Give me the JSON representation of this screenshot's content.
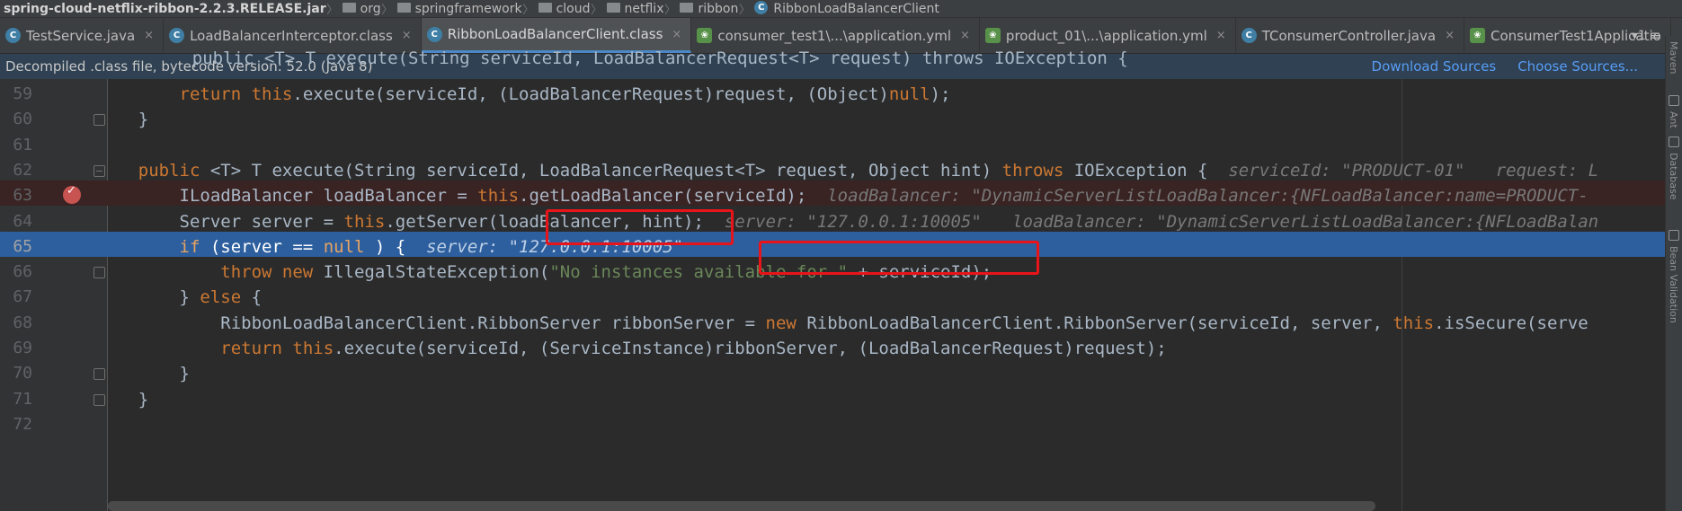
{
  "breadcrumb": {
    "items": [
      "spring-cloud-netflix-ribbon-2.2.3.RELEASE.jar",
      "org",
      "springframework",
      "cloud",
      "netflix",
      "ribbon",
      "RibbonLoadBalancerClient"
    ]
  },
  "tabs": [
    {
      "label": "TestService.java",
      "icon": "java-class-icon"
    },
    {
      "label": "LoadBalancerInterceptor.class",
      "icon": "class-file-icon"
    },
    {
      "label": "RibbonLoadBalancerClient.class",
      "icon": "class-file-icon",
      "active": true
    },
    {
      "label": "consumer_test1\\...\\application.yml",
      "icon": "spring-yml-icon"
    },
    {
      "label": "product_01\\...\\application.yml",
      "icon": "spring-yml-icon"
    },
    {
      "label": "TConsumerController.java",
      "icon": "java-class-icon"
    },
    {
      "label": "ConsumerTest1Applicatio",
      "icon": "spring-app-icon"
    }
  ],
  "tab_close": "×",
  "tab_overflow": "▾1 ≡",
  "banner": {
    "text": "Decompiled .class file, bytecode version: 52.0 (Java 8)",
    "download_sources": "Download Sources",
    "choose_sources": "Choose Sources..."
  },
  "right_strip": {
    "maven": "Maven",
    "ant": "Ant",
    "database": "Database",
    "bean_validation": "Bean Validation"
  },
  "code": {
    "partial_top": "    public <T> T execute(String serviceId, LoadBalancerRequest<T> request) throws IOException {",
    "lines": [
      {
        "num": "59",
        "parts": [
          [
            "",
            "        "
          ],
          [
            "kw",
            "return"
          ],
          [
            "",
            " "
          ],
          [
            "kw",
            "this"
          ],
          [
            "",
            ".execute(serviceId, (LoadBalancerRequest)request, (Object)"
          ],
          [
            "kw",
            "null"
          ],
          [
            "",
            ");"
          ]
        ]
      },
      {
        "num": "60",
        "parts": [
          [
            "",
            "    }"
          ]
        ]
      },
      {
        "num": "61",
        "parts": [
          [
            "",
            ""
          ]
        ]
      },
      {
        "num": "62",
        "parts": [
          [
            "",
            "    "
          ],
          [
            "kw",
            "public"
          ],
          [
            "",
            " <T> T execute(String serviceId, LoadBalancerRequest<T> request, Object hint) "
          ],
          [
            "kw",
            "throws"
          ],
          [
            "",
            " IOException {  "
          ],
          [
            "hint",
            "serviceId: \"PRODUCT-01\"   request: L"
          ]
        ]
      },
      {
        "num": "63",
        "parts": [
          [
            "",
            "        ILoadBalancer loadBalancer = "
          ],
          [
            "kw",
            "this"
          ],
          [
            "",
            ".getLoadBalancer(serviceId);  "
          ],
          [
            "hint",
            "loadBalancer: \"DynamicServerListLoadBalancer:{NFLoadBalancer:name=PRODUCT-"
          ]
        ]
      },
      {
        "num": "64",
        "parts": [
          [
            "",
            "        Server server = "
          ],
          [
            "kw",
            "this"
          ],
          [
            "",
            ".getServer(loadBalancer, hint);  "
          ],
          [
            "hint",
            "server: \"127.0.0.1:10005\"   loadBalancer: \"DynamicServerListLoadBalancer:{NFLoadBalan"
          ]
        ]
      },
      {
        "num": "65",
        "parts": [
          [
            "",
            "        "
          ],
          [
            "kw",
            "if"
          ],
          [
            "",
            " (server == "
          ],
          [
            "kw",
            "null"
          ],
          [
            "",
            " ) {  "
          ],
          [
            "hint",
            "server: \"127.0.0.1:10005\""
          ]
        ]
      },
      {
        "num": "66",
        "parts": [
          [
            "",
            "            "
          ],
          [
            "kw",
            "throw new"
          ],
          [
            "",
            " IllegalStateException("
          ],
          [
            "str",
            "\"No instances available for \""
          ],
          [
            "",
            " + serviceId);"
          ]
        ]
      },
      {
        "num": "67",
        "parts": [
          [
            "",
            "        } "
          ],
          [
            "kw",
            "else"
          ],
          [
            "",
            " {"
          ]
        ]
      },
      {
        "num": "68",
        "parts": [
          [
            "",
            "            RibbonLoadBalancerClient.RibbonServer ribbonServer = "
          ],
          [
            "kw",
            "new"
          ],
          [
            "",
            " RibbonLoadBalancerClient.RibbonServer(serviceId, server, "
          ],
          [
            "kw",
            "this"
          ],
          [
            "",
            ".isSecure(serve"
          ]
        ]
      },
      {
        "num": "69",
        "parts": [
          [
            "",
            "            "
          ],
          [
            "kw",
            "return"
          ],
          [
            "",
            " "
          ],
          [
            "kw",
            "this"
          ],
          [
            "",
            ".execute(serviceId, (ServiceInstance)ribbonServer, (LoadBalancerRequest)request);"
          ]
        ]
      },
      {
        "num": "70",
        "parts": [
          [
            "",
            "        }"
          ]
        ]
      },
      {
        "num": "71",
        "parts": [
          [
            "",
            "    }"
          ]
        ]
      },
      {
        "num": "72",
        "parts": [
          [
            "",
            ""
          ]
        ]
      }
    ]
  },
  "colors": {
    "keyword": "#cc7832",
    "string": "#6a8759",
    "hint": "#787878",
    "selection": "#2d5f9e",
    "highlight_box": "#e8141a"
  }
}
